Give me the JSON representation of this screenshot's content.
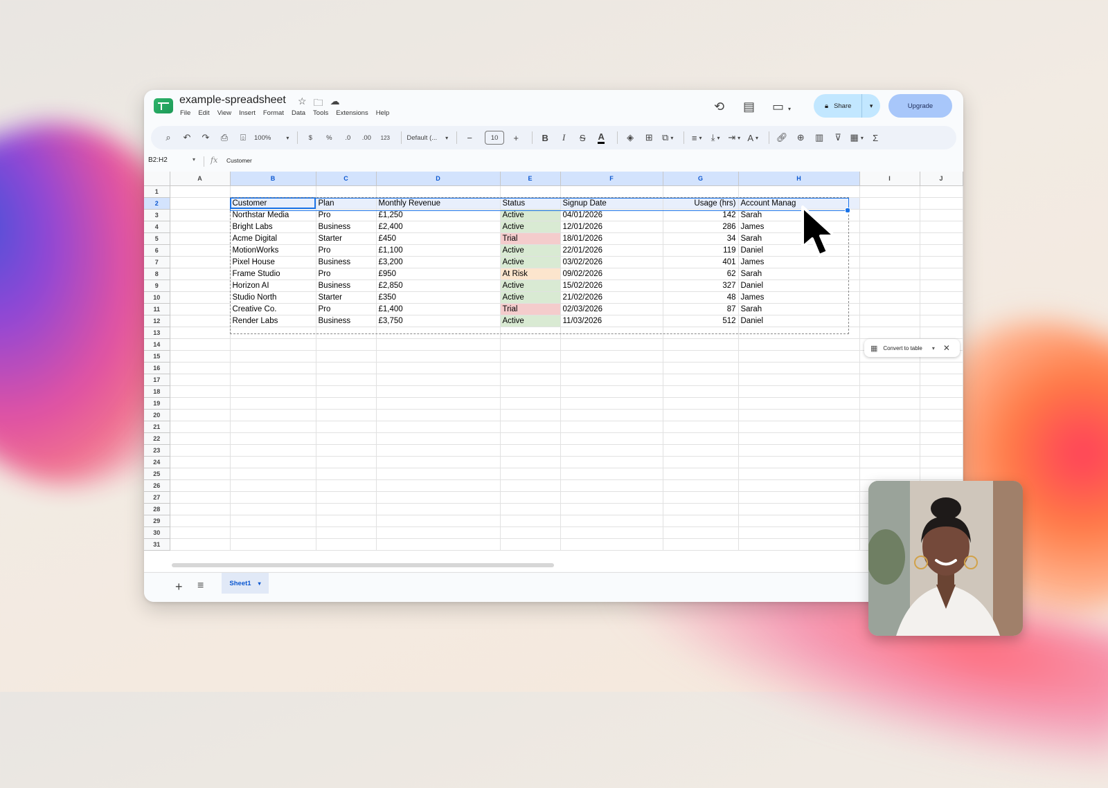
{
  "doc": {
    "title": "example-spreadsheet",
    "menu": [
      "File",
      "Edit",
      "View",
      "Insert",
      "Format",
      "Data",
      "Tools",
      "Extensions",
      "Help"
    ]
  },
  "header": {
    "share_label": "Share",
    "upgrade_label": "Upgrade"
  },
  "toolbar": {
    "zoom": "100%",
    "currency": "$",
    "percent": "%",
    "decrease_decimal": ".0",
    "increase_decimal": ".00",
    "number_format": "123",
    "font": "Default (...",
    "font_size": "10"
  },
  "formula_bar": {
    "name_box": "B2:H2",
    "value": "Customer"
  },
  "grid": {
    "columns": [
      "A",
      "B",
      "C",
      "D",
      "E",
      "F",
      "G",
      "H",
      "I",
      "J"
    ],
    "header_row": [
      "Customer",
      "Plan",
      "Monthly Revenue",
      "Status",
      "Signup Date",
      "Usage (hrs)",
      "Account Manag"
    ],
    "rows": [
      [
        "Northstar Media",
        "Pro",
        "£1,250",
        "Active",
        "04/01/2026",
        "142",
        "Sarah"
      ],
      [
        "Bright Labs",
        "Business",
        "£2,400",
        "Active",
        "12/01/2026",
        "286",
        "James"
      ],
      [
        "Acme Digital",
        "Starter",
        "£450",
        "Trial",
        "18/01/2026",
        "34",
        "Sarah"
      ],
      [
        "MotionWorks",
        "Pro",
        "£1,100",
        "Active",
        "22/01/2026",
        "119",
        "Daniel"
      ],
      [
        "Pixel House",
        "Business",
        "£3,200",
        "Active",
        "03/02/2026",
        "401",
        "James"
      ],
      [
        "Frame Studio",
        "Pro",
        "£950",
        "At Risk",
        "09/02/2026",
        "62",
        "Sarah"
      ],
      [
        "Horizon AI",
        "Business",
        "£2,850",
        "Active",
        "15/02/2026",
        "327",
        "Daniel"
      ],
      [
        "Studio North",
        "Starter",
        "£350",
        "Active",
        "21/02/2026",
        "48",
        "James"
      ],
      [
        "Creative Co.",
        "Pro",
        "£1,400",
        "Trial",
        "02/03/2026",
        "87",
        "Sarah"
      ],
      [
        "Render Labs",
        "Business",
        "£3,750",
        "Active",
        "11/03/2026",
        "512",
        "Daniel"
      ]
    ],
    "row_count": 31,
    "status_colors": {
      "Active": "#d9ead3",
      "Trial": "#f4cccc",
      "At Risk": "#fce5cd"
    }
  },
  "convert_chip": {
    "label": "Convert to table"
  },
  "tabs": {
    "sheet_name": "Sheet1"
  },
  "colors": {
    "accent": "#1a73e8",
    "share_bg": "#c2e7ff",
    "upgrade_bg": "#a8c7fa"
  }
}
